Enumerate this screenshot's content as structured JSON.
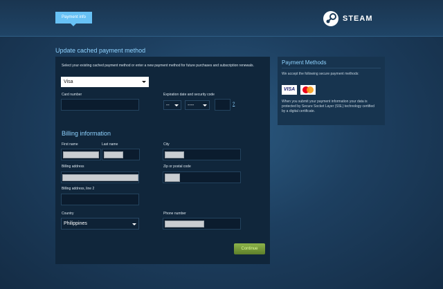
{
  "header": {
    "tab_label": "Payment info",
    "logo_text": "STEAM"
  },
  "form": {
    "section_title": "Update cached payment method",
    "intro": "Select your existing cached payment method or enter a new payment method for future purchases and subscription renewals.",
    "payment_method_value": "Visa",
    "card_number_label": "Card number",
    "expiration_label": "Expiration date and security code",
    "exp_month_value": "--",
    "exp_year_value": "----",
    "help_link": "?",
    "billing_title": "Billing information",
    "first_name_label": "First name",
    "last_name_label": "Last name",
    "city_label": "City",
    "billing_address_label": "Billing address",
    "zip_label": "Zip or postal code",
    "billing_address2_label": "Billing address, line 2",
    "country_label": "Country",
    "country_value": "Philippines",
    "phone_label": "Phone number",
    "continue_label": "Continue"
  },
  "side": {
    "title": "Payment Methods",
    "accept_text": "We accept the following secure payment methods:",
    "visa_label": "VISA",
    "security_text": "When you submit your payment information your data is protected by Secure Socket Layer (SSL) technology certified by a digital certificate."
  },
  "colors": {
    "accent": "#67c1f5",
    "heading": "#8fd3ff",
    "button": "#6f9a31"
  }
}
